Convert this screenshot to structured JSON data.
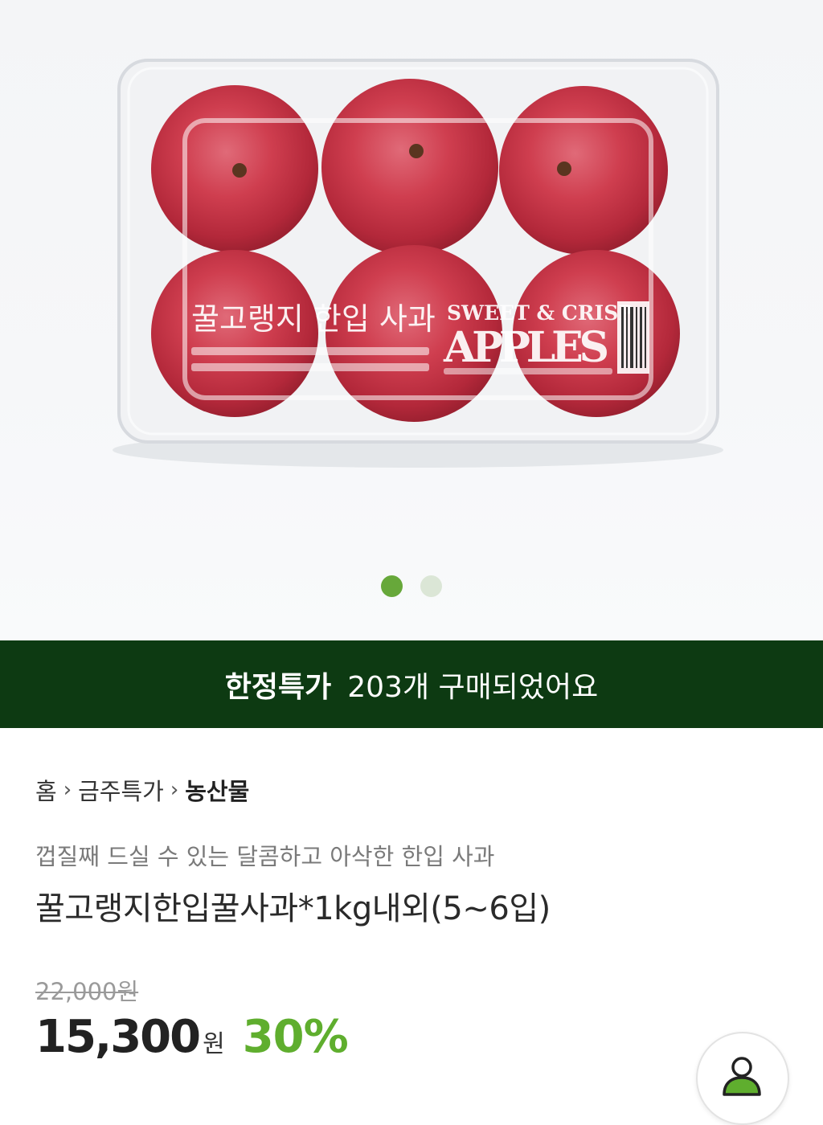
{
  "hero": {
    "package_label_korean": "꿀고랭지 한입 사과",
    "package_label_english_top": "SWEET & CRISP",
    "package_label_english_main": "APPLES",
    "carousel_total": 2,
    "carousel_active_index": 0
  },
  "promo": {
    "label": "한정특가",
    "purchased_text": "203개 구매되었어요"
  },
  "breadcrumb": {
    "home": "홈",
    "category": "금주특가",
    "current": "농산물",
    "separator": "›"
  },
  "product": {
    "subtitle": "껍질째 드실 수 있는 달콤하고 아삭한 한입 사과",
    "title": "꿀고랭지한입꿀사과*1kg내외(5~6입)",
    "original_price": "22,000원",
    "sale_price": "15,300",
    "currency": "원",
    "discount": "30%"
  },
  "colors": {
    "promo_background": "#0d3a12",
    "accent_green": "#5fae2e",
    "dot_active": "#67a83a",
    "dot_inactive": "#dbe6d6"
  },
  "icons": {
    "fab": "person-icon"
  }
}
